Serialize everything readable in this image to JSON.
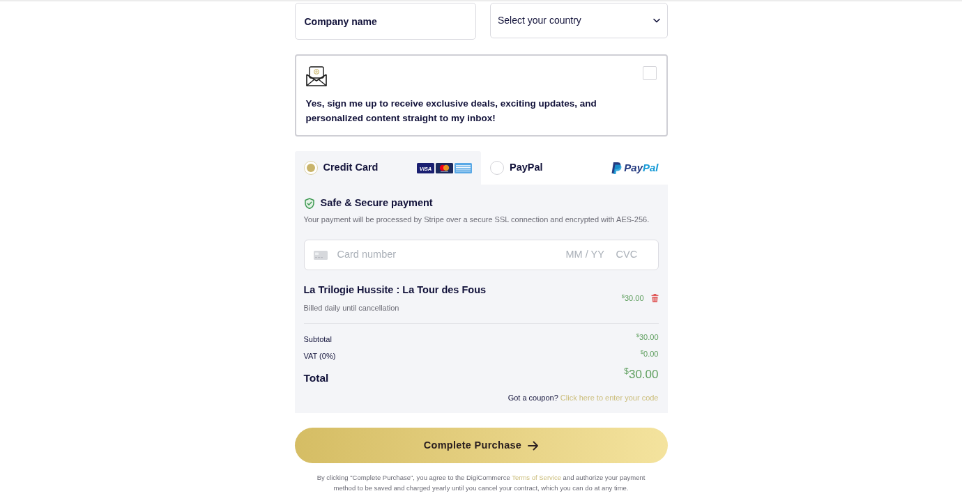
{
  "fields": [
    {
      "kind": "text",
      "placeholder": "Company name"
    },
    {
      "kind": "select",
      "value": "Select your country"
    }
  ],
  "newsletter": {
    "text": "Yes, sign me up to receive exclusive deals, exciting updates, and personalized content straight to my inbox!",
    "checked": false
  },
  "payment_methods": [
    {
      "kind": "card",
      "label": "Credit Card",
      "selected": true,
      "brands": [
        {
          "kind": "visa",
          "label": "VISA"
        },
        {
          "kind": "mastercard"
        },
        {
          "kind": "amex"
        }
      ]
    },
    {
      "kind": "paypal",
      "label": "PayPal",
      "selected": false,
      "logo": [
        "Pay",
        "Pal"
      ]
    }
  ],
  "security": {
    "title": "Safe & Secure payment",
    "description": "Your payment will be processed by Stripe over a secure SSL connection and encrypted with AES-256."
  },
  "card_field": {
    "number_placeholder": "Card number",
    "expiry_placeholder": "MM / YY",
    "cvc_placeholder": "CVC"
  },
  "items": [
    {
      "name": "La Trilogie Hussite : La Tour des Fous",
      "note": "Billed daily until cancellation",
      "currency": "$",
      "amount": "30.00"
    }
  ],
  "totals": [
    {
      "kind": "line",
      "label": "Subtotal",
      "currency": "$",
      "amount": "30.00"
    },
    {
      "kind": "line",
      "label": "VAT (0%)",
      "currency": "$",
      "amount": "0.00"
    },
    {
      "kind": "total",
      "label": "Total",
      "currency": "$",
      "amount": "30.00"
    }
  ],
  "coupon": {
    "prompt": "Got a coupon?",
    "link": "Click here to enter your code"
  },
  "submit_button": {
    "label": "Complete Purchase"
  },
  "legal": {
    "before": "By clicking \"Complete Purchase\", you agree to the DigiCommerce ",
    "link": "Terms of Service",
    "after": " and authorize your payment method to be saved and charged yearly until you cancel your contract, which you can do at any time."
  }
}
